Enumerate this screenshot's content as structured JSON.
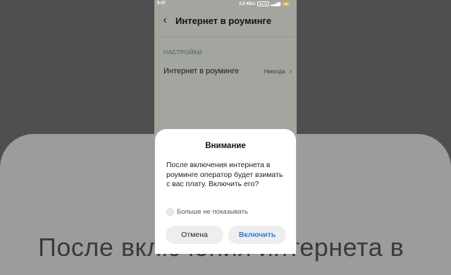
{
  "status_bar": {
    "time": "9:47",
    "network_speed": "0,0 КБ/с",
    "volte": "VoLTE",
    "battery": "35"
  },
  "header": {
    "back_icon": "chevron-left-icon",
    "title": "Интернет в роуминге"
  },
  "settings": {
    "section_label": "НАСТРОЙКИ",
    "row": {
      "label": "Интернет в роуминге",
      "value": "Никогда"
    }
  },
  "dialog": {
    "title": "Внимание",
    "message": "После включения интернета в роуминге оператор будет взимать с вас плату. Включить его?",
    "checkbox_label": "Больше не показывать",
    "checkbox_checked": false,
    "cancel_label": "Отмена",
    "confirm_label": "Включить"
  },
  "background": {
    "overlay_text": "После включения интернета в"
  },
  "colors": {
    "accent": "#2d7be3",
    "screen_bg": "#a3a69e",
    "dialog_bg": "#ffffff"
  }
}
